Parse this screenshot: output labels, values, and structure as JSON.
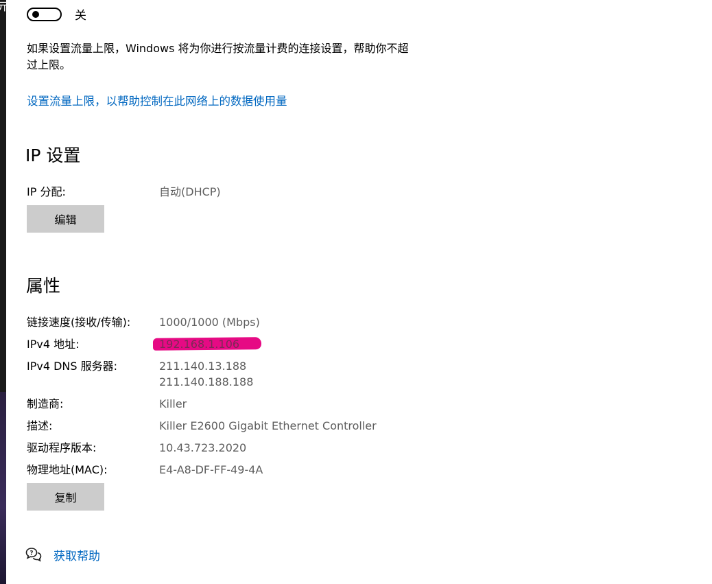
{
  "metered": {
    "toggle_state": "关",
    "toggle_on": false,
    "description": "如果设置流量上限，Windows 将为你进行按流量计费的连接设置，帮助你不超过上限。",
    "data_limit_link": "设置流量上限，以帮助控制在此网络上的数据使用量"
  },
  "ip_settings": {
    "title": "IP 设置",
    "assignment_label": "IP 分配:",
    "assignment_value": "自动(DHCP)",
    "edit_button": "编辑"
  },
  "properties": {
    "title": "属性",
    "link_speed_label": "链接速度(接收/传输):",
    "link_speed_value": "1000/1000 (Mbps)",
    "ipv4_label": "IPv4 地址:",
    "ipv4_value": "192.168.1.106",
    "dns_label": "IPv4 DNS 服务器:",
    "dns_values": [
      "211.140.13.188",
      "211.140.188.188"
    ],
    "manufacturer_label": "制造商:",
    "manufacturer_value": "Killer",
    "description_label": "描述:",
    "description_value": "Killer E2600 Gigabit Ethernet Controller",
    "driver_label": "驱动程序版本:",
    "driver_value": "10.43.723.2020",
    "mac_label": "物理地址(MAC):",
    "mac_value": "E4-A8-DF-FF-49-4A",
    "copy_button": "复制"
  },
  "help": {
    "icon": "help-chat-icon",
    "label": "获取帮助"
  },
  "colors": {
    "link": "#0067c0",
    "button_bg": "#cccccc",
    "secondary_text": "#5d5d5d",
    "redaction_marker": "#e5007f"
  }
}
